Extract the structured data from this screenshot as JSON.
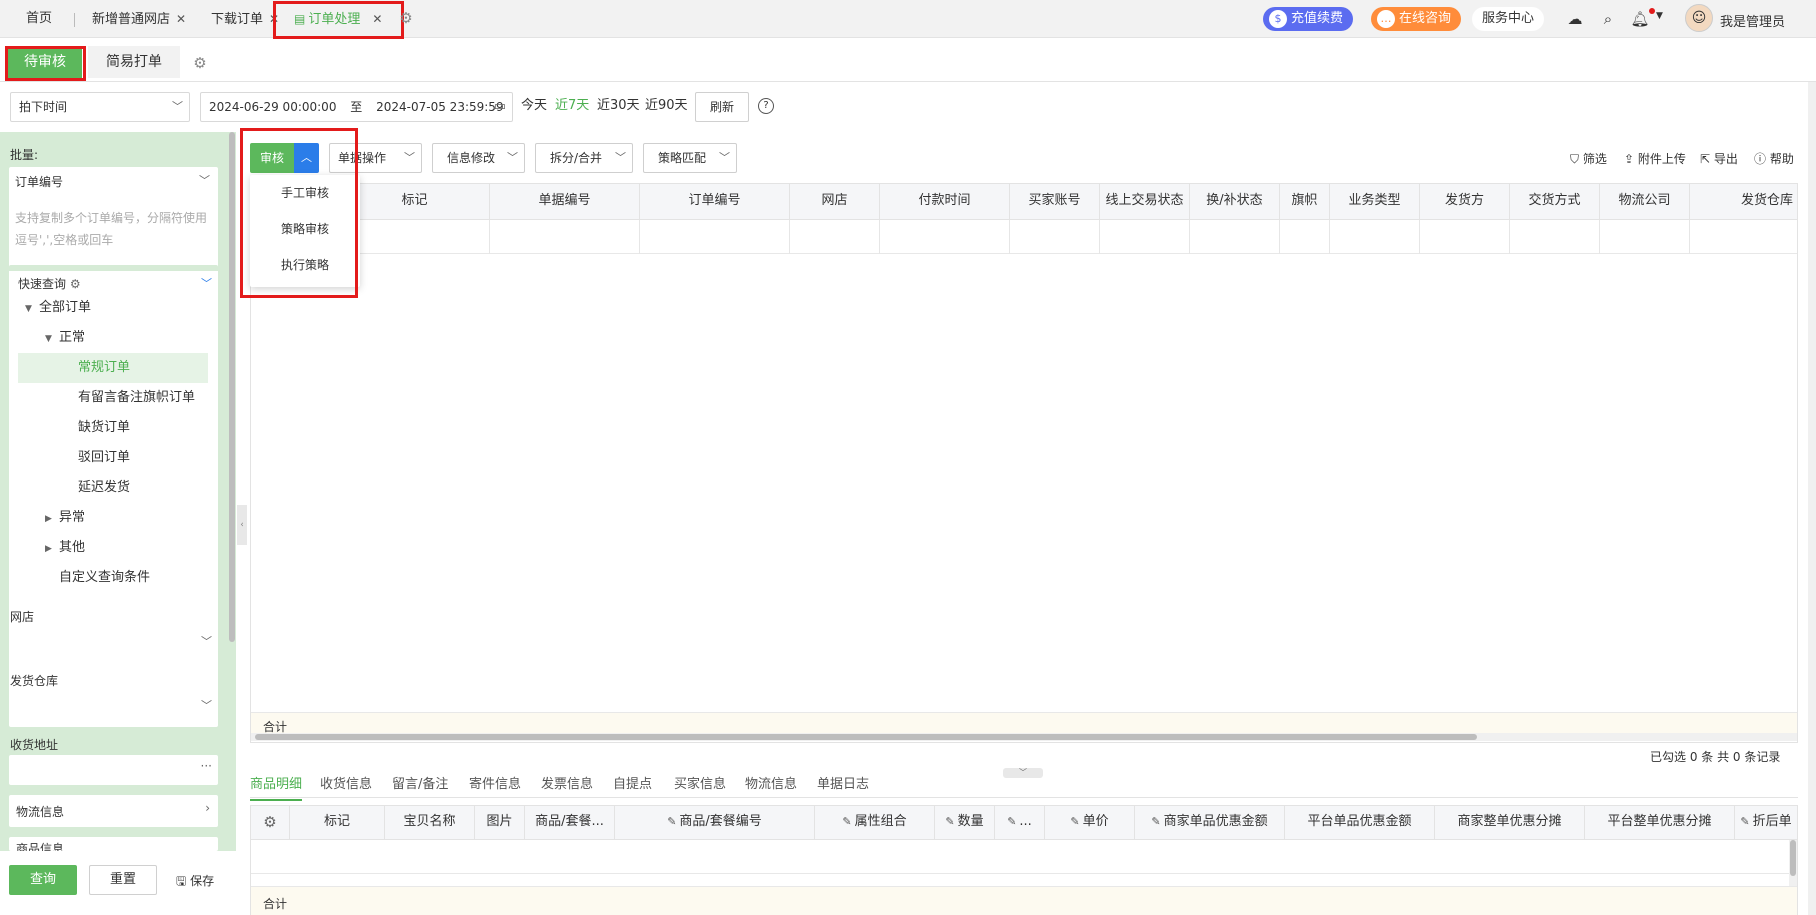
{
  "topbar": {
    "tabs": [
      {
        "label": "首页"
      },
      {
        "label": "新增普通网店"
      },
      {
        "label": "下载订单"
      },
      {
        "label": "订单处理"
      }
    ],
    "recharge": "充值续费",
    "consult": "在线咨询",
    "service": "服务中心",
    "user": "我是管理员",
    "colors": {
      "recharge": "#5b6cf0",
      "consult": "#ff8c3a",
      "accent": "#4caf50"
    }
  },
  "subtabs": {
    "pending": "待审核",
    "simple_print": "简易打单"
  },
  "filter": {
    "time_type": "拍下时间",
    "date_start": "2024-06-29 00:00:00",
    "date_sep": "至",
    "date_end": "2024-07-05 23:59:59",
    "quick": [
      "今天",
      "近7天",
      "近30天",
      "近90天"
    ],
    "refresh": "刷新"
  },
  "sidebar": {
    "batch_label": "批量:",
    "batch_field": "订单编号",
    "batch_placeholder": "支持复制多个订单编号，分隔符使用逗号',',空格或回车",
    "quick_query": "快速查询",
    "tree": {
      "all": "全部订单",
      "normal": "正常",
      "items": [
        "常规订单",
        "有留言备注旗帜订单",
        "缺货订单",
        "驳回订单",
        "延迟发货"
      ],
      "abnormal": "异常",
      "other": "其他",
      "custom": "自定义查询条件"
    },
    "shop_label": "网店",
    "warehouse_label": "发货仓库",
    "address_label": "收货地址",
    "logistics_label": "物流信息",
    "goods_label": "商品信息",
    "query": "查询",
    "reset": "重置",
    "save": "保存"
  },
  "toolbar": {
    "audit": "审核",
    "doc_ops": "单据操作",
    "info_edit": "信息修改",
    "split_merge": "拆分/合并",
    "strategy_match": "策略匹配",
    "filter": "筛选",
    "attach_upload": "附件上传",
    "export": "导出",
    "help": "帮助"
  },
  "audit_menu": [
    "手工审核",
    "策略审核",
    "执行策略"
  ],
  "main_table": {
    "columns": [
      "标记",
      "单据编号",
      "订单编号",
      "网店",
      "付款时间",
      "买家账号",
      "线上交易状态",
      "换/补状态",
      "旗帜",
      "业务类型",
      "发货方",
      "交货方式",
      "物流公司",
      "发货仓库"
    ],
    "total_label": "合计",
    "status": "已勾选 0 条  共 0 条记录"
  },
  "detail": {
    "tabs": [
      "商品明细",
      "收货信息",
      "留言/备注",
      "寄件信息",
      "发票信息",
      "自提点",
      "买家信息",
      "物流信息",
      "单据日志"
    ],
    "columns": [
      "标记",
      "宝贝名称",
      "图片",
      "商品/套餐...",
      "商品/套餐编号",
      "属性组合",
      "数量",
      "...",
      "单价",
      "商家单品优惠金额",
      "平台单品优惠金额",
      "商家整单优惠分摊",
      "平台整单优惠分摊",
      "折后单"
    ],
    "total_label": "合计"
  }
}
